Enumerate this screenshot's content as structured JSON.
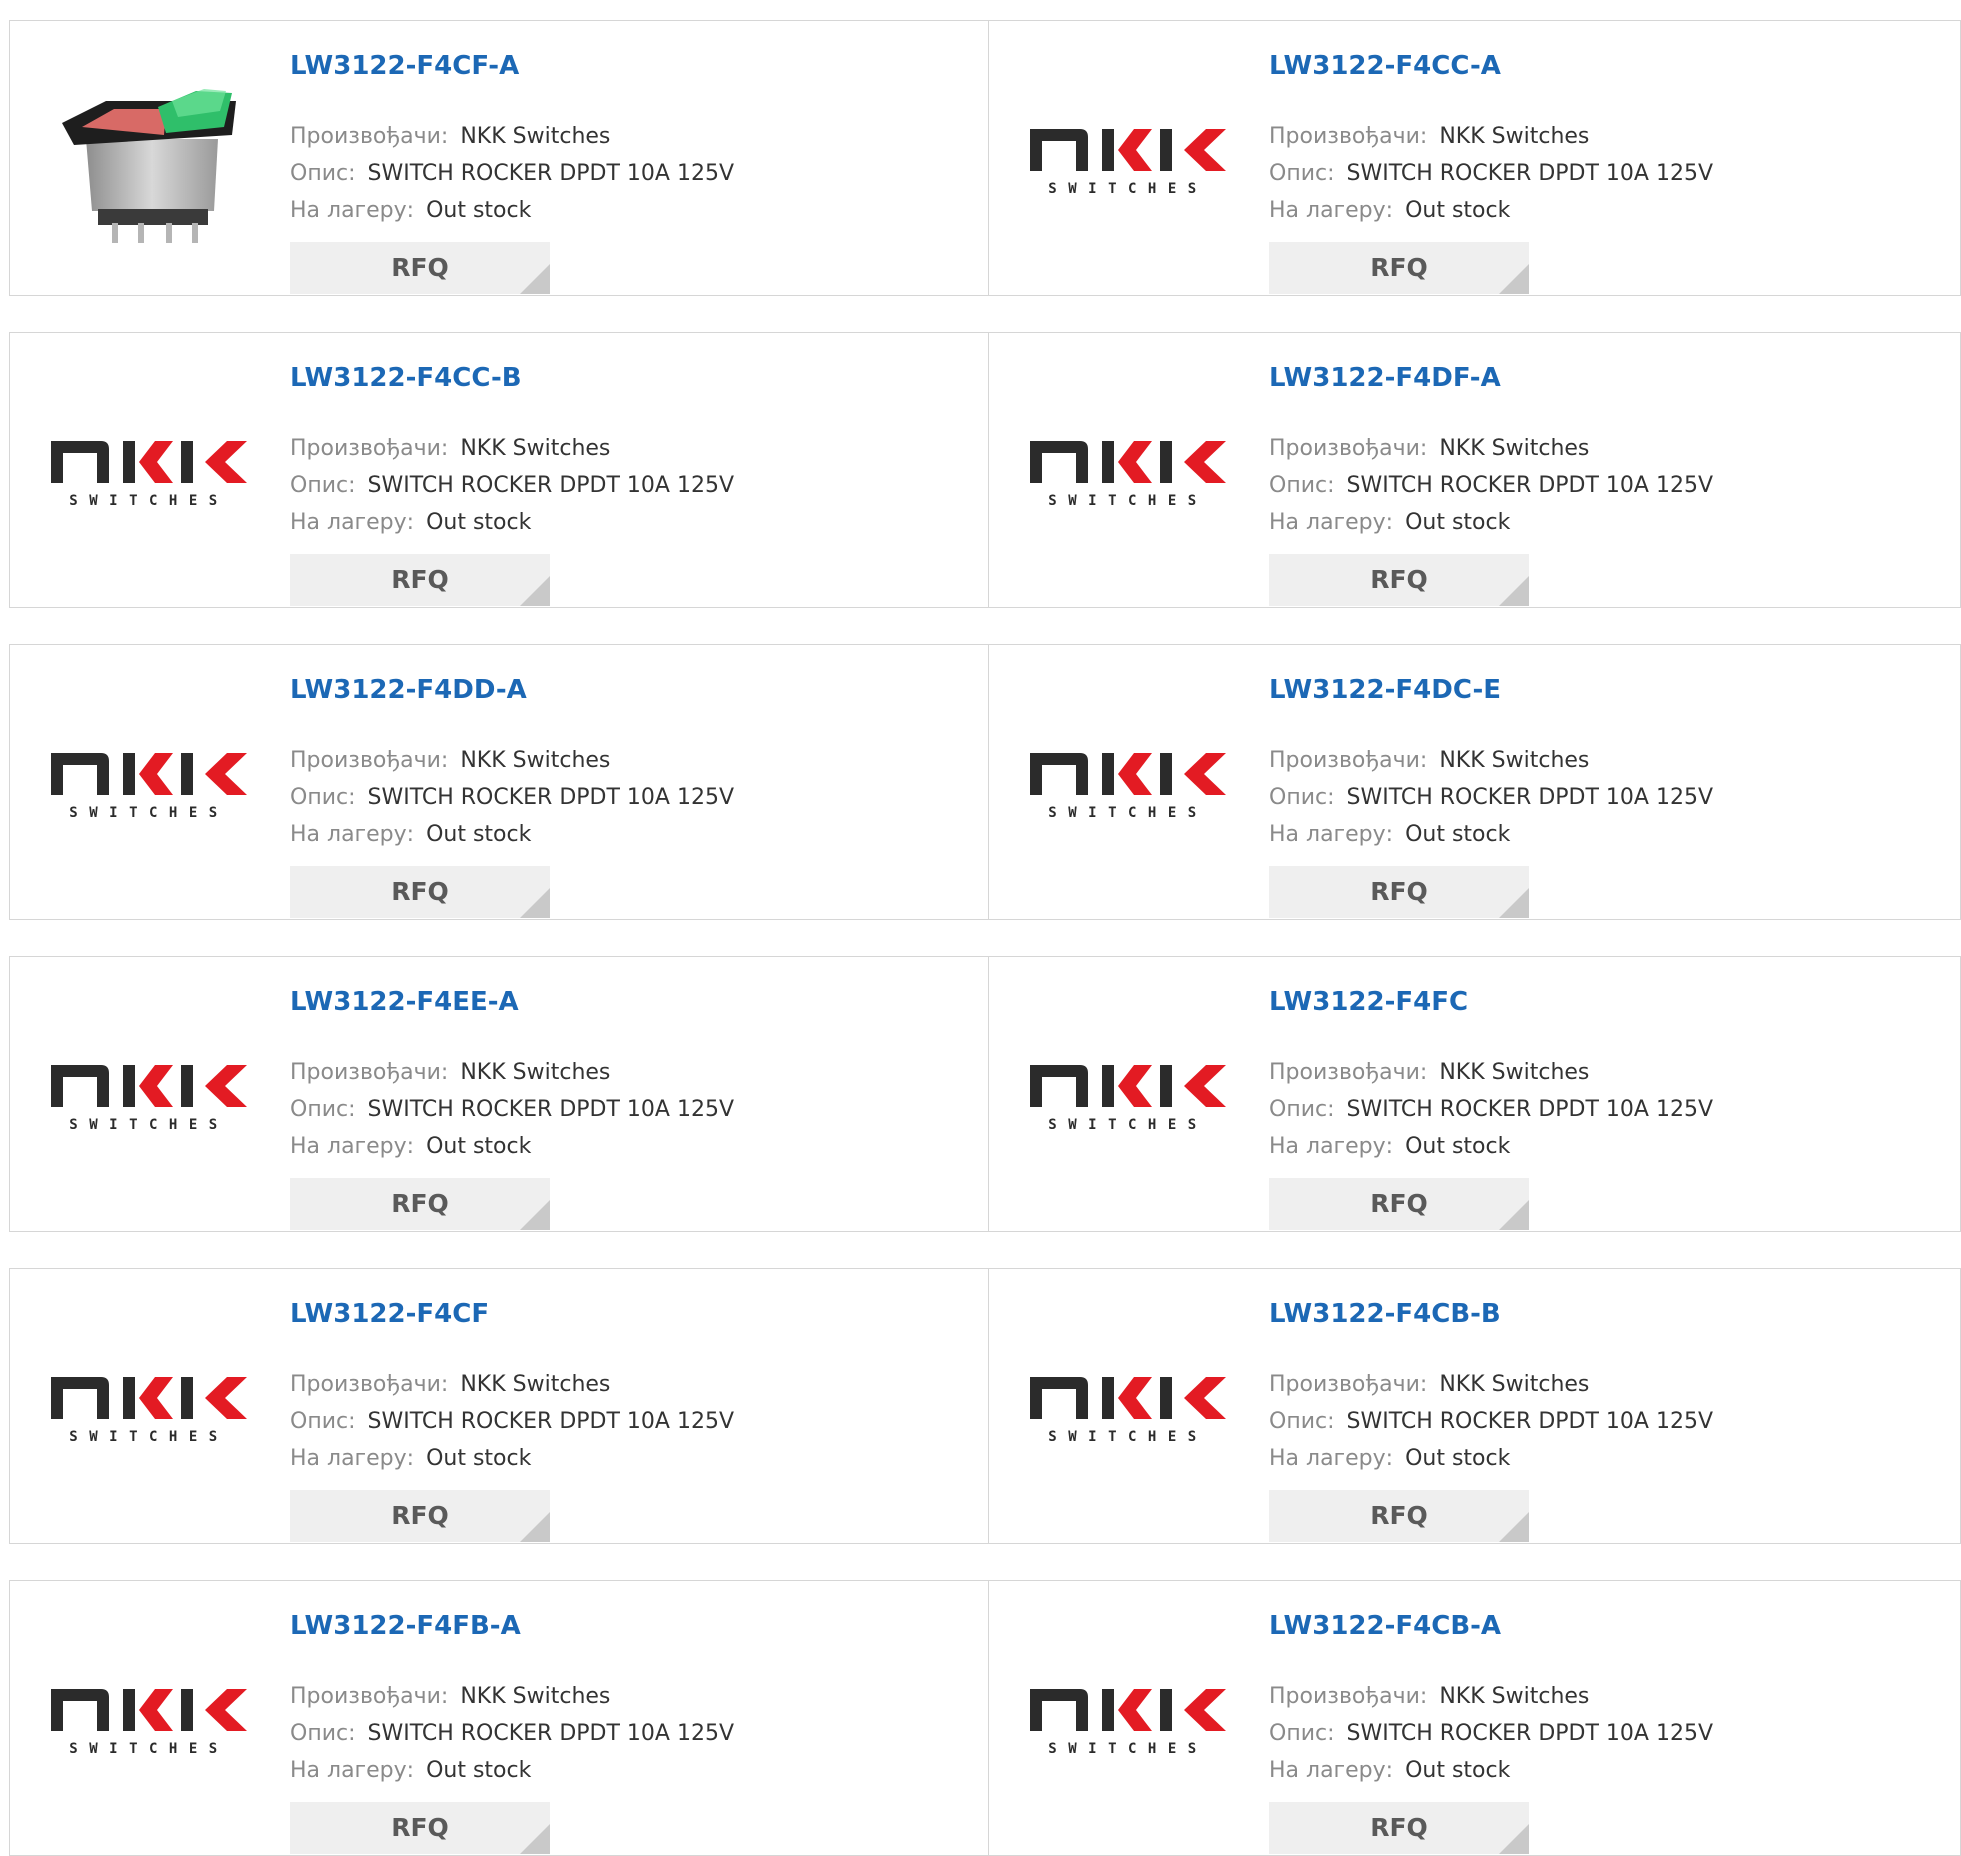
{
  "labels": {
    "manufacturer": "Произвођачи:",
    "description": "Опис:",
    "stock": "На лагеру:",
    "rfq": "RFQ"
  },
  "logo": {
    "main": "NKK",
    "sub": "SWITCHES"
  },
  "colors": {
    "link": "#1c68b5",
    "logo_red": "#e31b23",
    "logo_dark": "#2b2b2b"
  },
  "products": [
    {
      "part": "LW3122-F4CF-A",
      "manufacturer": "NKK Switches",
      "description": "SWITCH ROCKER DPDT 10A 125V",
      "stock": "Out stock",
      "image": "rocker-switch-photo"
    },
    {
      "part": "LW3122-F4CC-A",
      "manufacturer": "NKK Switches",
      "description": "SWITCH ROCKER DPDT 10A 125V",
      "stock": "Out stock",
      "image": "nkk-logo"
    },
    {
      "part": "LW3122-F4CC-B",
      "manufacturer": "NKK Switches",
      "description": "SWITCH ROCKER DPDT 10A 125V",
      "stock": "Out stock",
      "image": "nkk-logo"
    },
    {
      "part": "LW3122-F4DF-A",
      "manufacturer": "NKK Switches",
      "description": "SWITCH ROCKER DPDT 10A 125V",
      "stock": "Out stock",
      "image": "nkk-logo"
    },
    {
      "part": "LW3122-F4DD-A",
      "manufacturer": "NKK Switches",
      "description": "SWITCH ROCKER DPDT 10A 125V",
      "stock": "Out stock",
      "image": "nkk-logo"
    },
    {
      "part": "LW3122-F4DC-E",
      "manufacturer": "NKK Switches",
      "description": "SWITCH ROCKER DPDT 10A 125V",
      "stock": "Out stock",
      "image": "nkk-logo"
    },
    {
      "part": "LW3122-F4EE-A",
      "manufacturer": "NKK Switches",
      "description": "SWITCH ROCKER DPDT 10A 125V",
      "stock": "Out stock",
      "image": "nkk-logo"
    },
    {
      "part": "LW3122-F4FC",
      "manufacturer": "NKK Switches",
      "description": "SWITCH ROCKER DPDT 10A 125V",
      "stock": "Out stock",
      "image": "nkk-logo"
    },
    {
      "part": "LW3122-F4CF",
      "manufacturer": "NKK Switches",
      "description": "SWITCH ROCKER DPDT 10A 125V",
      "stock": "Out stock",
      "image": "nkk-logo"
    },
    {
      "part": "LW3122-F4CB-B",
      "manufacturer": "NKK Switches",
      "description": "SWITCH ROCKER DPDT 10A 125V",
      "stock": "Out stock",
      "image": "nkk-logo"
    },
    {
      "part": "LW3122-F4FB-A",
      "manufacturer": "NKK Switches",
      "description": "SWITCH ROCKER DPDT 10A 125V",
      "stock": "Out stock",
      "image": "nkk-logo"
    },
    {
      "part": "LW3122-F4CB-A",
      "manufacturer": "NKK Switches",
      "description": "SWITCH ROCKER DPDT 10A 125V",
      "stock": "Out stock",
      "image": "nkk-logo"
    }
  ]
}
